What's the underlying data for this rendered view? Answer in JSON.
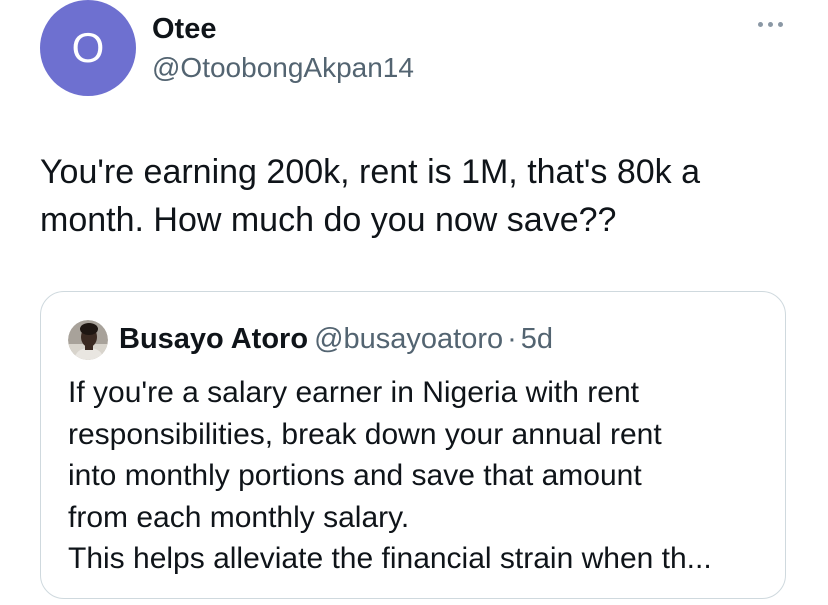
{
  "author": {
    "avatar_initial": "O",
    "avatar_color": "#6e70d0",
    "display_name": "Otee",
    "handle": "@OtoobongAkpan14"
  },
  "more_icon": "more-horizontal-icon",
  "tweet": {
    "text_lines": [
      "You're earning 200k, rent is 1M, that's 80k a",
      "month. How much do you now save??"
    ]
  },
  "quote": {
    "author_name": "Busayo Atoro",
    "author_handle": "@busayoatoro",
    "separator": "·",
    "time": "5d",
    "text_lines": [
      "If you're a salary earner in Nigeria with rent",
      "responsibilities, break down your annual rent",
      "into monthly portions and save that amount",
      "from each monthly salary.",
      "This helps alleviate the financial strain when th..."
    ]
  },
  "colors": {
    "text_primary": "#0f1419",
    "text_secondary": "#536471",
    "border": "#cfd9de"
  }
}
